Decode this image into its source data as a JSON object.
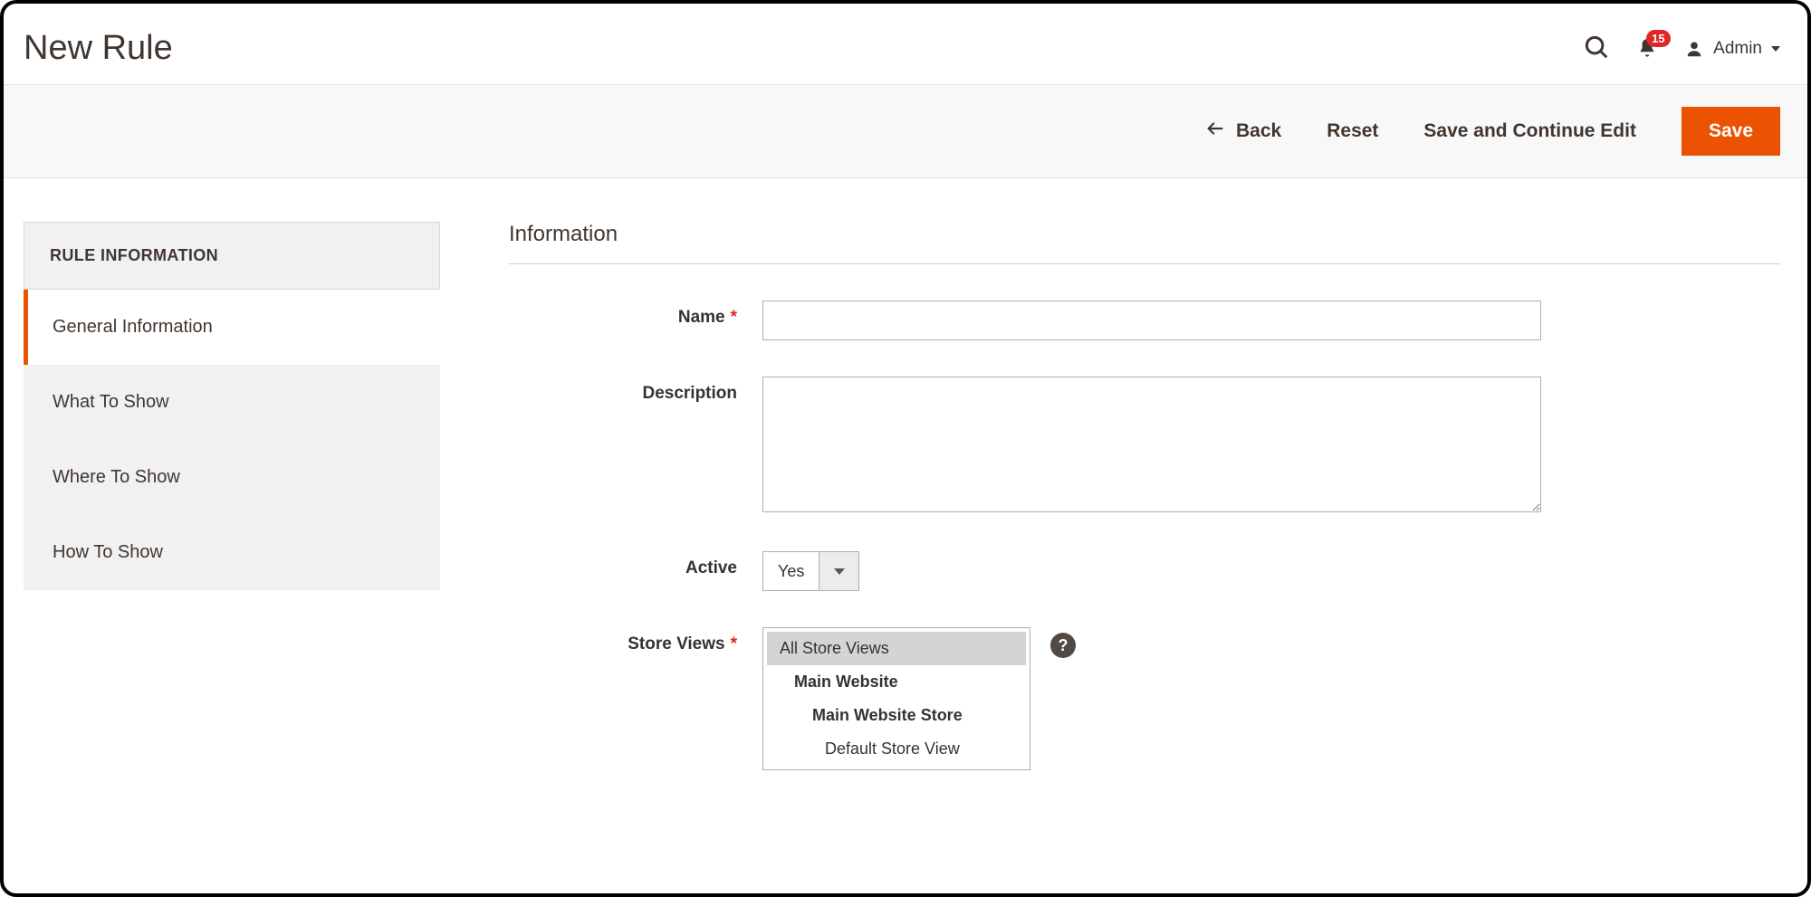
{
  "header": {
    "page_title": "New Rule",
    "notification_count": "15",
    "admin_name": "Admin"
  },
  "actions": {
    "back": "Back",
    "reset": "Reset",
    "save_continue": "Save and Continue Edit",
    "save": "Save"
  },
  "sidebar": {
    "title": "RULE INFORMATION",
    "tabs": [
      {
        "label": "General Information"
      },
      {
        "label": "What To Show"
      },
      {
        "label": "Where To Show"
      },
      {
        "label": "How To Show"
      }
    ]
  },
  "form": {
    "section_heading": "Information",
    "name": {
      "label": "Name",
      "value": ""
    },
    "description": {
      "label": "Description",
      "value": ""
    },
    "active": {
      "label": "Active",
      "value": "Yes"
    },
    "store_views": {
      "label": "Store Views",
      "options": {
        "all": "All Store Views",
        "website": "Main Website",
        "store": "Main Website Store",
        "view": "Default Store View"
      }
    },
    "help_tooltip_glyph": "?"
  }
}
